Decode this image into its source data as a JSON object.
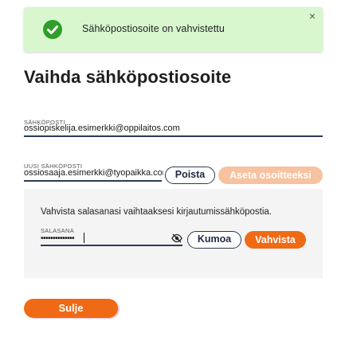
{
  "notification": {
    "message": "Sähköpostiosoite on vahvistettu",
    "close_symbol": "×",
    "icon": "check-circle-icon",
    "color": "#2f9e2a",
    "background": "#d9f7cf"
  },
  "page": {
    "title": "Vaihda sähköpostiosoite"
  },
  "current_email": {
    "label": "SÄHKÖPOSTI",
    "value": "ossiopiskelija.esimerkki@oppilaitos.com"
  },
  "new_email": {
    "label": "UUSI SÄHKÖPOSTI",
    "value": "ossiosaaja.esimerkki@tyopaikka.com",
    "remove_label": "Poista",
    "set_address_label": "Aseta osoitteeksi"
  },
  "confirm": {
    "instruction": "Vahvista salasanasi vaihtaaksesi kirjautumissähköpostia.",
    "password_label": "SALASANA",
    "password_value": "••••••••••••••",
    "show_password_icon": "eye-slash-icon",
    "cancel_label": "Kumoa",
    "confirm_label": "Vahvista"
  },
  "footer": {
    "close_label": "Sulje"
  },
  "colors": {
    "accent": "#f06a15",
    "accent_disabled": "#f7c2a0",
    "navy": "#2b3a55"
  }
}
